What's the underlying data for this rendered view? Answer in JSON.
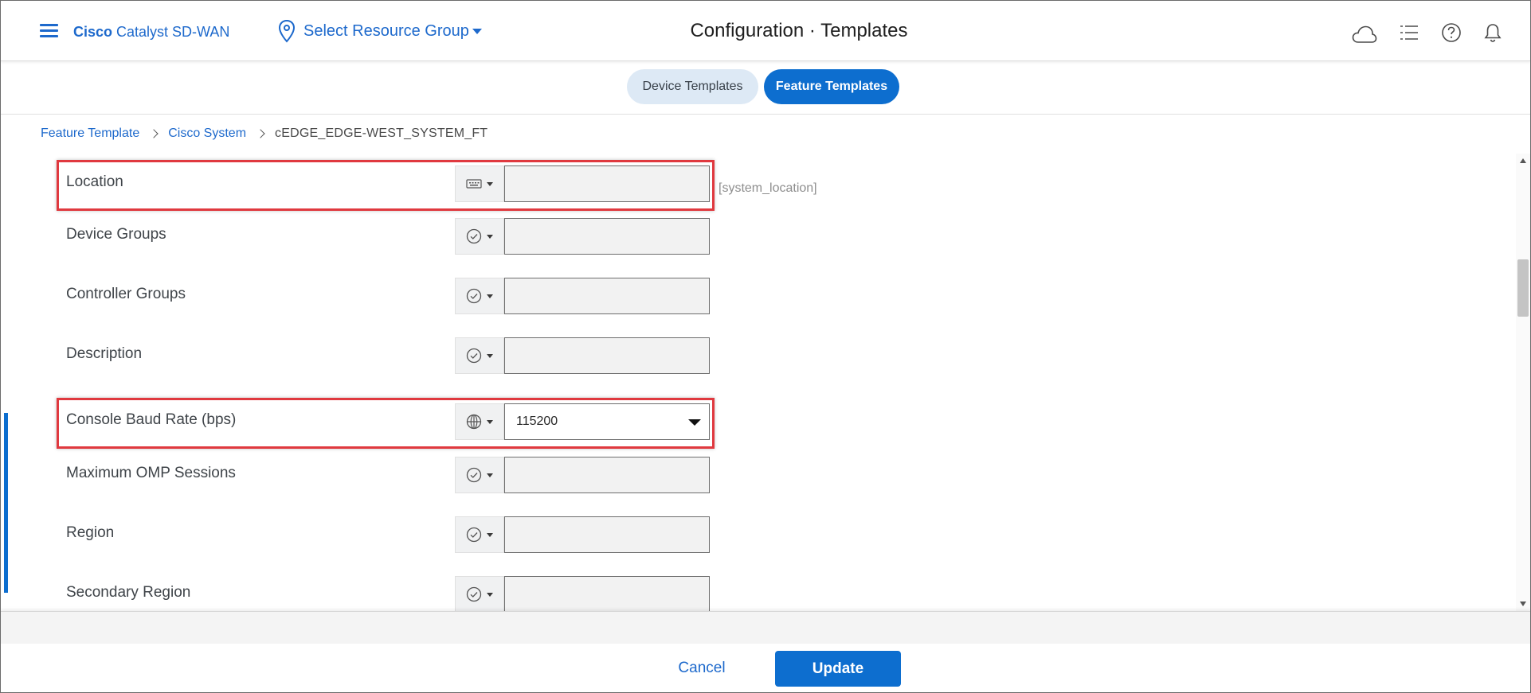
{
  "app": {
    "brand_bold": "Cisco",
    "brand_rest": " Catalyst SD-WAN",
    "resource_group_label": "Select Resource Group",
    "page_title": "Configuration · Templates"
  },
  "header_icons": [
    "cloud-icon",
    "task-list-icon",
    "help-icon",
    "notification-bell-icon"
  ],
  "tabs": [
    {
      "label": "Device Templates",
      "active": false
    },
    {
      "label": "Feature Templates",
      "active": true
    }
  ],
  "breadcrumb": {
    "items": [
      "Feature Template",
      "Cisco System"
    ],
    "current": "cEDGE_EDGE-WEST_SYSTEM_FT"
  },
  "form": {
    "rows": [
      {
        "label": "Location",
        "scope": "device-specific",
        "scope_icon": "device-specific-icon",
        "value": "",
        "variable_hint": "[system_location]",
        "highlighted": true
      },
      {
        "label": "Device Groups",
        "scope": "default",
        "scope_icon": "default-check-icon",
        "value": ""
      },
      {
        "label": "Controller Groups",
        "scope": "default",
        "scope_icon": "default-check-icon",
        "value": ""
      },
      {
        "label": "Description",
        "scope": "default",
        "scope_icon": "default-check-icon",
        "value": ""
      },
      {
        "label": "Console Baud Rate (bps)",
        "scope": "global",
        "scope_icon": "global-icon",
        "value": "115200",
        "highlighted": true
      },
      {
        "label": "Maximum OMP Sessions",
        "scope": "default",
        "scope_icon": "default-check-icon",
        "value": ""
      },
      {
        "label": "Region",
        "scope": "default",
        "scope_icon": "default-check-icon",
        "value": ""
      },
      {
        "label": "Secondary Region",
        "scope": "default",
        "scope_icon": "default-check-icon",
        "value": ""
      }
    ]
  },
  "footer": {
    "cancel_label": "Cancel",
    "update_label": "Update"
  },
  "colors": {
    "accent": "#0d6ecf",
    "link": "#1d69cc",
    "highlight_border": "#e0393f"
  }
}
